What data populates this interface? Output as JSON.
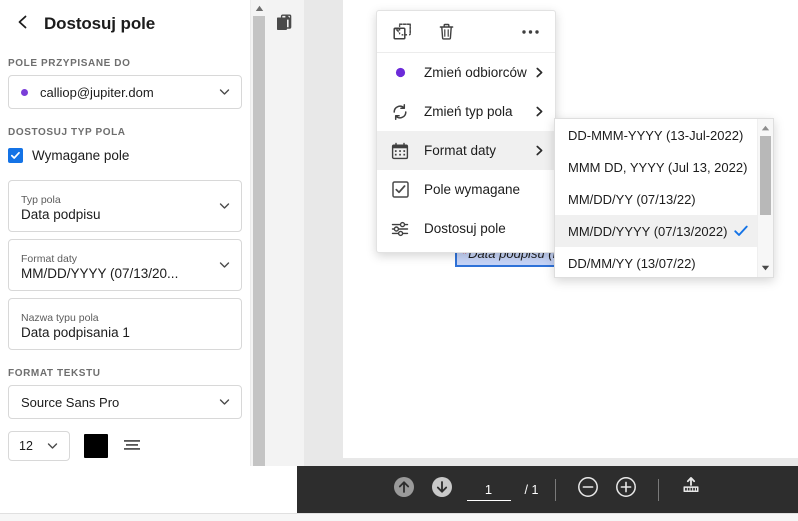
{
  "panel": {
    "title": "Dostosuj pole",
    "back_icon": "chevron-left-icon",
    "sections": {
      "assigned_to_label": "POLE PRZYPISANE DO",
      "assignee_value": "calliop@jupiter.dom",
      "customize_type_label": "DOSTOSUJ TYP POLA",
      "required_checkbox_label": "Wymagane pole",
      "required_checked": true,
      "text_format_label": "FORMAT TEKSTU"
    },
    "fields": [
      {
        "label": "Typ pola",
        "value": "Data podpisu"
      },
      {
        "label": "Format daty",
        "value": "MM/DD/YYYY (07/13/20..."
      },
      {
        "label": "Nazwa typu pola",
        "value": "Data podpisania 1"
      }
    ],
    "font_family_value": "Source Sans Pro",
    "font_size_value": "12",
    "font_color": "#000000",
    "align_icon": "text-align-icon"
  },
  "doc": {
    "duplicate_icon": "duplicate-pages-icon",
    "signature_field": {
      "required_marker": "*",
      "text": "Data podpisu (MM/DD/YY",
      "border_color": "#2f72d8",
      "fill_color": "#c6d4f7"
    }
  },
  "context_menu": {
    "toolbar_icons": [
      {
        "name": "duplicate-field-icon",
        "label": ""
      },
      {
        "name": "delete-field-icon",
        "label": ""
      },
      {
        "name": "more-options-icon",
        "label": ""
      }
    ],
    "items": [
      {
        "icon": "recipient-dot-icon",
        "label": "Zmień odbiorców",
        "submenu": true,
        "highlighted": false,
        "accent": "#7a3ed8"
      },
      {
        "icon": "change-field-type-icon",
        "label": "Zmień typ pola",
        "submenu": true,
        "highlighted": false
      },
      {
        "icon": "calendar-icon",
        "label": "Format daty",
        "submenu": true,
        "highlighted": true
      },
      {
        "icon": "checked-box-icon",
        "label": "Pole wymagane",
        "submenu": false,
        "highlighted": false
      },
      {
        "icon": "sliders-icon",
        "label": "Dostosuj pole",
        "submenu": false,
        "highlighted": false
      }
    ]
  },
  "date_submenu": {
    "options": [
      {
        "label": "DD-MMM-YYYY (13-Jul-2022)",
        "selected": false
      },
      {
        "label": "MMM DD, YYYY (Jul 13, 2022)",
        "selected": false
      },
      {
        "label": "MM/DD/YY (07/13/22)",
        "selected": false
      },
      {
        "label": "MM/DD/YYYY (07/13/2022)",
        "selected": true
      },
      {
        "label": "DD/MM/YY (13/07/22)",
        "selected": false
      }
    ],
    "check_color": "#1473e6"
  },
  "bottom_bar": {
    "prev_page_icon": "arrow-up-circle-icon",
    "next_page_icon": "arrow-down-circle-icon",
    "page_value": "1",
    "page_total": "/ 1",
    "zoom_out_icon": "minus-circle-icon",
    "zoom_in_icon": "plus-circle-icon",
    "fit_icon": "upload-fit-icon",
    "background": "#2d2d2d"
  }
}
